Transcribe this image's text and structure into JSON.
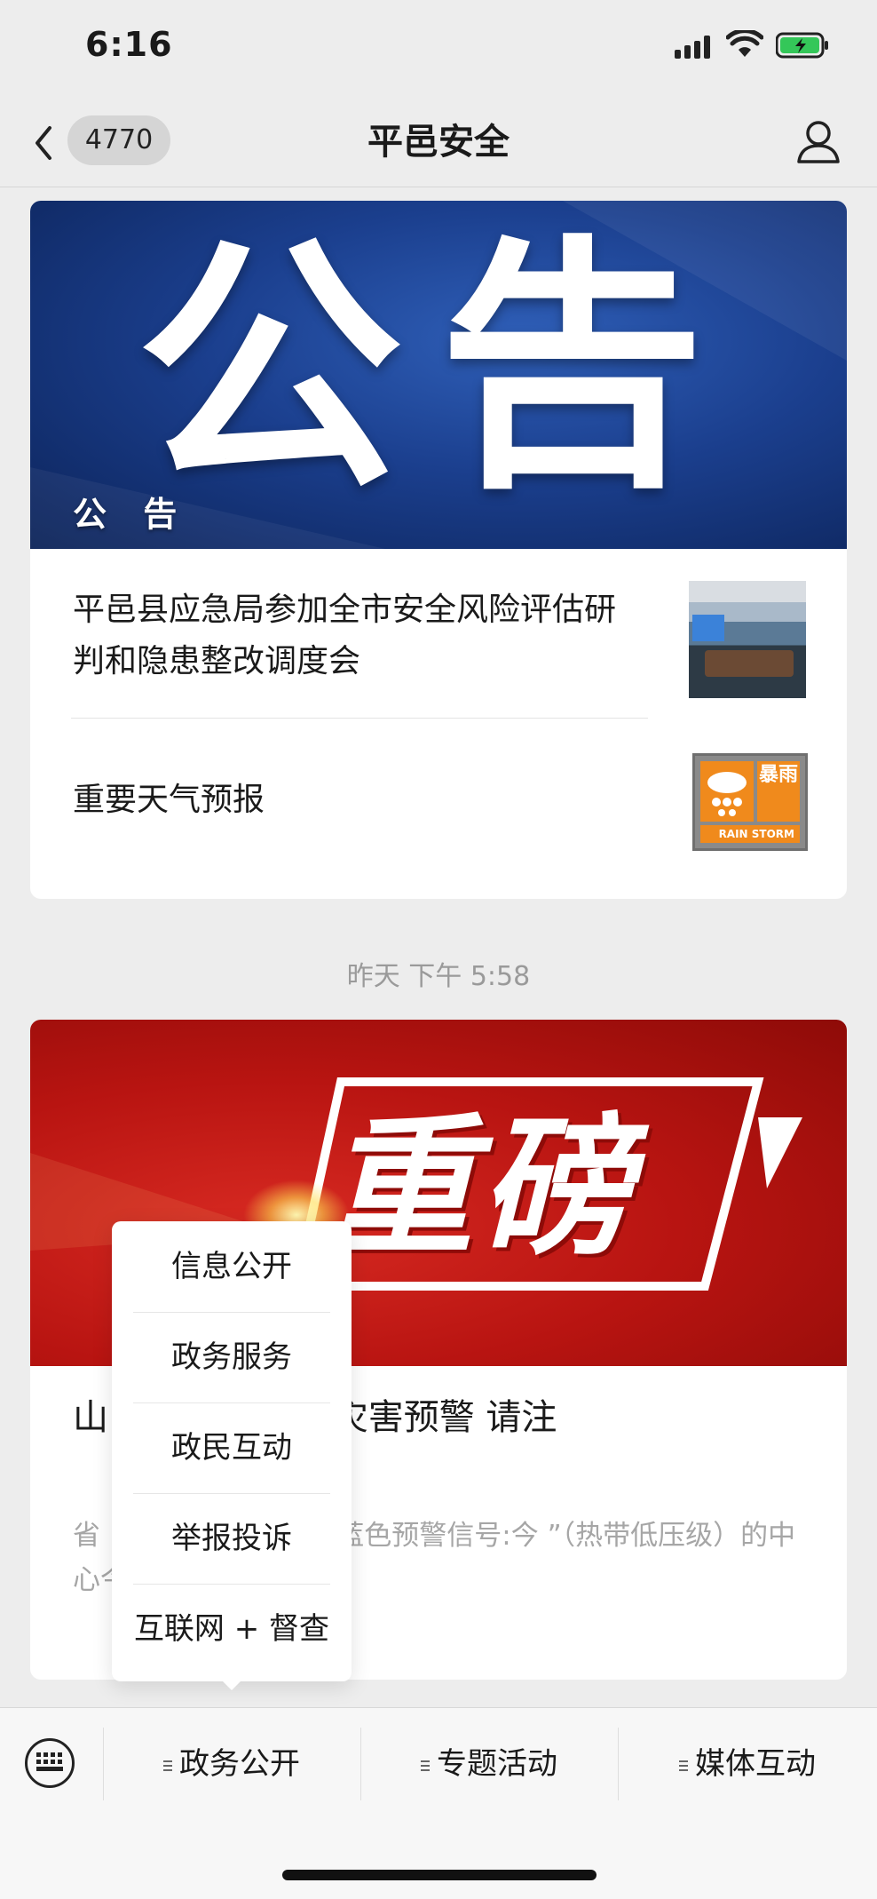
{
  "status_bar": {
    "time": "6:16"
  },
  "nav": {
    "unread_count": "4770",
    "title": "平邑安全"
  },
  "article_group_1": {
    "banner_big_text": "公告",
    "banner_caption": "公 告",
    "items": [
      {
        "title": "平邑县应急局参加全市安全风险评估研判和隐患整改调度会"
      },
      {
        "title": "重要天气预报"
      }
    ],
    "rain_badge": {
      "right_text": "暴雨",
      "bottom_text": "RAIN STORM"
    }
  },
  "timestamp": "昨天 下午 5:58",
  "article_group_2": {
    "banner_big_text": "重磅",
    "headline": "山东发布台风蓝色预警和地质灾害预警 请注意防范",
    "headline_visible": "山                    色预警和地质灾害预警 请注",
    "summary_visible": "省                    16时继续发布台风蓝色预警信号:今                    ”（热带低压级）的中心今天16时"
  },
  "popup_menu": {
    "items": [
      "信息公开",
      "政务服务",
      "政民互动",
      "举报投诉",
      "互联网 + 督查"
    ]
  },
  "tab_bar": {
    "tabs": [
      "政务公开",
      "专题活动",
      "媒体互动"
    ]
  },
  "colors": {
    "accent_red": "#b81411",
    "accent_blue": "#1b3f8e",
    "badge_orange": "#f08a1c",
    "battery_green": "#34c759"
  }
}
